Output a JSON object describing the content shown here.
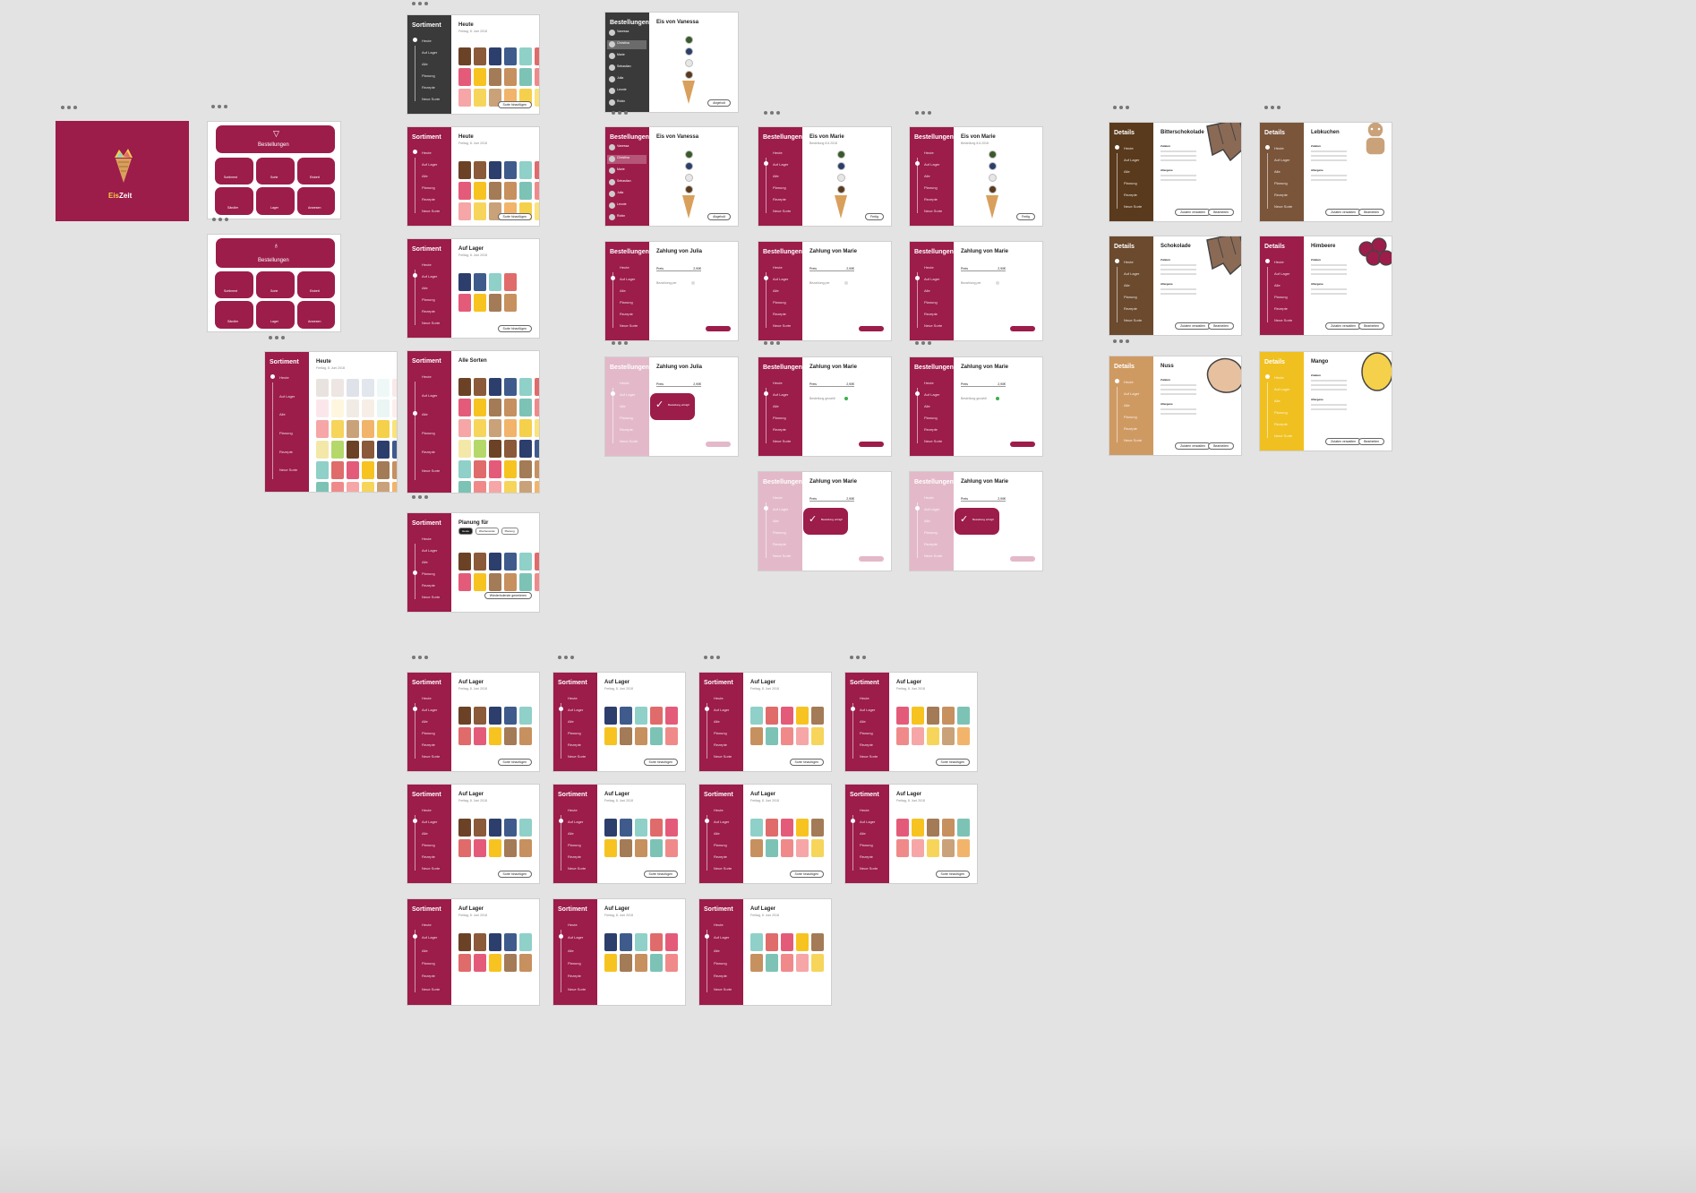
{
  "brand": {
    "name": "EisZeit",
    "name_part1": "Eis",
    "name_part2": "Zeit"
  },
  "colors": {
    "accent": "#9c1c4a",
    "canvas": "#e3e3e3",
    "dark_side": "#3a3a3a",
    "brown": "#5a3a1c",
    "chocolate_brown": "#6b4a2e",
    "mid_brown": "#7a553a",
    "tan": "#cf9a62",
    "yellow": "#f0c020"
  },
  "menu": {
    "title": "Bestellungen",
    "tiles": [
      "Sortiment",
      "Sorte",
      "Eisbett",
      "Sändler",
      "Lager",
      "Anwesen"
    ]
  },
  "sidebar": {
    "sortiment": "Sortiment",
    "bestellungen": "Bestellungen",
    "details": "Details",
    "items": [
      "Heute",
      "Auf Lager",
      "Alle",
      "Planung",
      "Rezepte",
      "Neue Sorte"
    ]
  },
  "screens": {
    "heute": {
      "title": "Heute",
      "date": "Freitag, 8. Juni 2018",
      "button": "Sorte hinzufügen"
    },
    "auf_lager": {
      "title": "Auf Lager",
      "date": "Freitag, 8. Juni 2018",
      "button": "Sorte hinzufügen"
    },
    "alle_sorten": {
      "title": "Alle Sorten"
    },
    "planung": {
      "title": "Planung für",
      "tabs": [
        "Heute",
        "Wochenende",
        "Planung"
      ],
      "button": "Sorte hinzufügen",
      "button2": "Wiederholende generieren"
    },
    "eis_vanessa": {
      "title": "Eis von Vanessa",
      "button": "Abgeholt"
    },
    "eis_marie": {
      "title": "Eis von Marie",
      "subtitle": "Bestellung 8.6.2018",
      "button": "Fertig"
    },
    "zahlung_julia": {
      "title": "Zahlung von Julia",
      "price_label": "Preis",
      "price": "2,90€",
      "method": "Bezahlung per",
      "paypal": "PayPal",
      "button": "Bezahlt"
    },
    "zahlung_marie": {
      "title": "Zahlung von Marie",
      "price_label": "Preis",
      "price": "2,90€",
      "method": "Bestellung gezahlt",
      "button": "Bezahlung"
    },
    "success": {
      "message": "Bestellung erfolgt!"
    }
  },
  "orders": [
    "Vanessa",
    "Christina",
    "Marie",
    "Sebastian",
    "Julia",
    "Leonie",
    "Robin"
  ],
  "details": [
    {
      "name": "Bitterschokolade",
      "color": "#5a3a1c",
      "illustration": "chocolate-icon"
    },
    {
      "name": "Schokolade",
      "color": "#6b4a2e",
      "illustration": "chocolate-icon"
    },
    {
      "name": "Nuss",
      "color": "#cf9a62",
      "illustration": "nut-icon"
    },
    {
      "name": "Lebkuchen",
      "color": "#7a553a",
      "illustration": "gingerbread-icon"
    },
    {
      "name": "Himbeere",
      "color": "#9c1c4a",
      "illustration": "raspberry-icon"
    },
    {
      "name": "Mango",
      "color": "#f0c020",
      "illustration": "mango-icon"
    }
  ],
  "detail_labels": {
    "zutaten": "Zutaten",
    "allergene": "Allergene",
    "btn1": "Zutaten verwalten",
    "btn2": "Bearbeiten"
  },
  "flavor_palette": [
    "#6b4226",
    "#8a5a3a",
    "#2c3e6b",
    "#3f5b8c",
    "#8fd0c8",
    "#e06b6b",
    "#e45b7a",
    "#f7c320",
    "#a37b56",
    "#c7905f",
    "#7cc3b6",
    "#f08a8a",
    "#f6a6a6",
    "#f6d55a",
    "#c9a27a",
    "#f2b46b",
    "#f5d04a",
    "#f9e37a",
    "#f3e8a8",
    "#b5d86a"
  ]
}
